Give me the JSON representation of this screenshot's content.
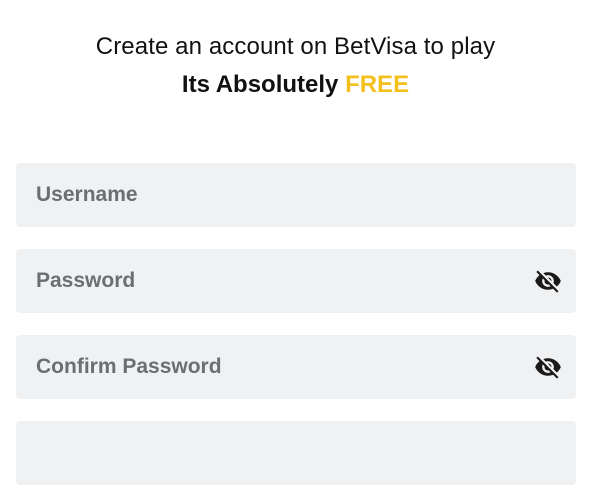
{
  "header": {
    "line1": "Create an account on BetVisa to play",
    "line2_prefix": "Its Absolutely ",
    "line2_highlight": "FREE",
    "accent_color": "#f4c01e"
  },
  "form": {
    "username": {
      "placeholder": "Username",
      "value": ""
    },
    "password": {
      "placeholder": "Password",
      "value": "",
      "toggle_icon": "eye-slash-icon"
    },
    "confirm_password": {
      "placeholder": "Confirm Password",
      "value": "",
      "toggle_icon": "eye-slash-icon"
    }
  },
  "colors": {
    "field_background": "#f0f1f3",
    "placeholder_text": "#6b6e73",
    "heading_text": "#111111"
  }
}
